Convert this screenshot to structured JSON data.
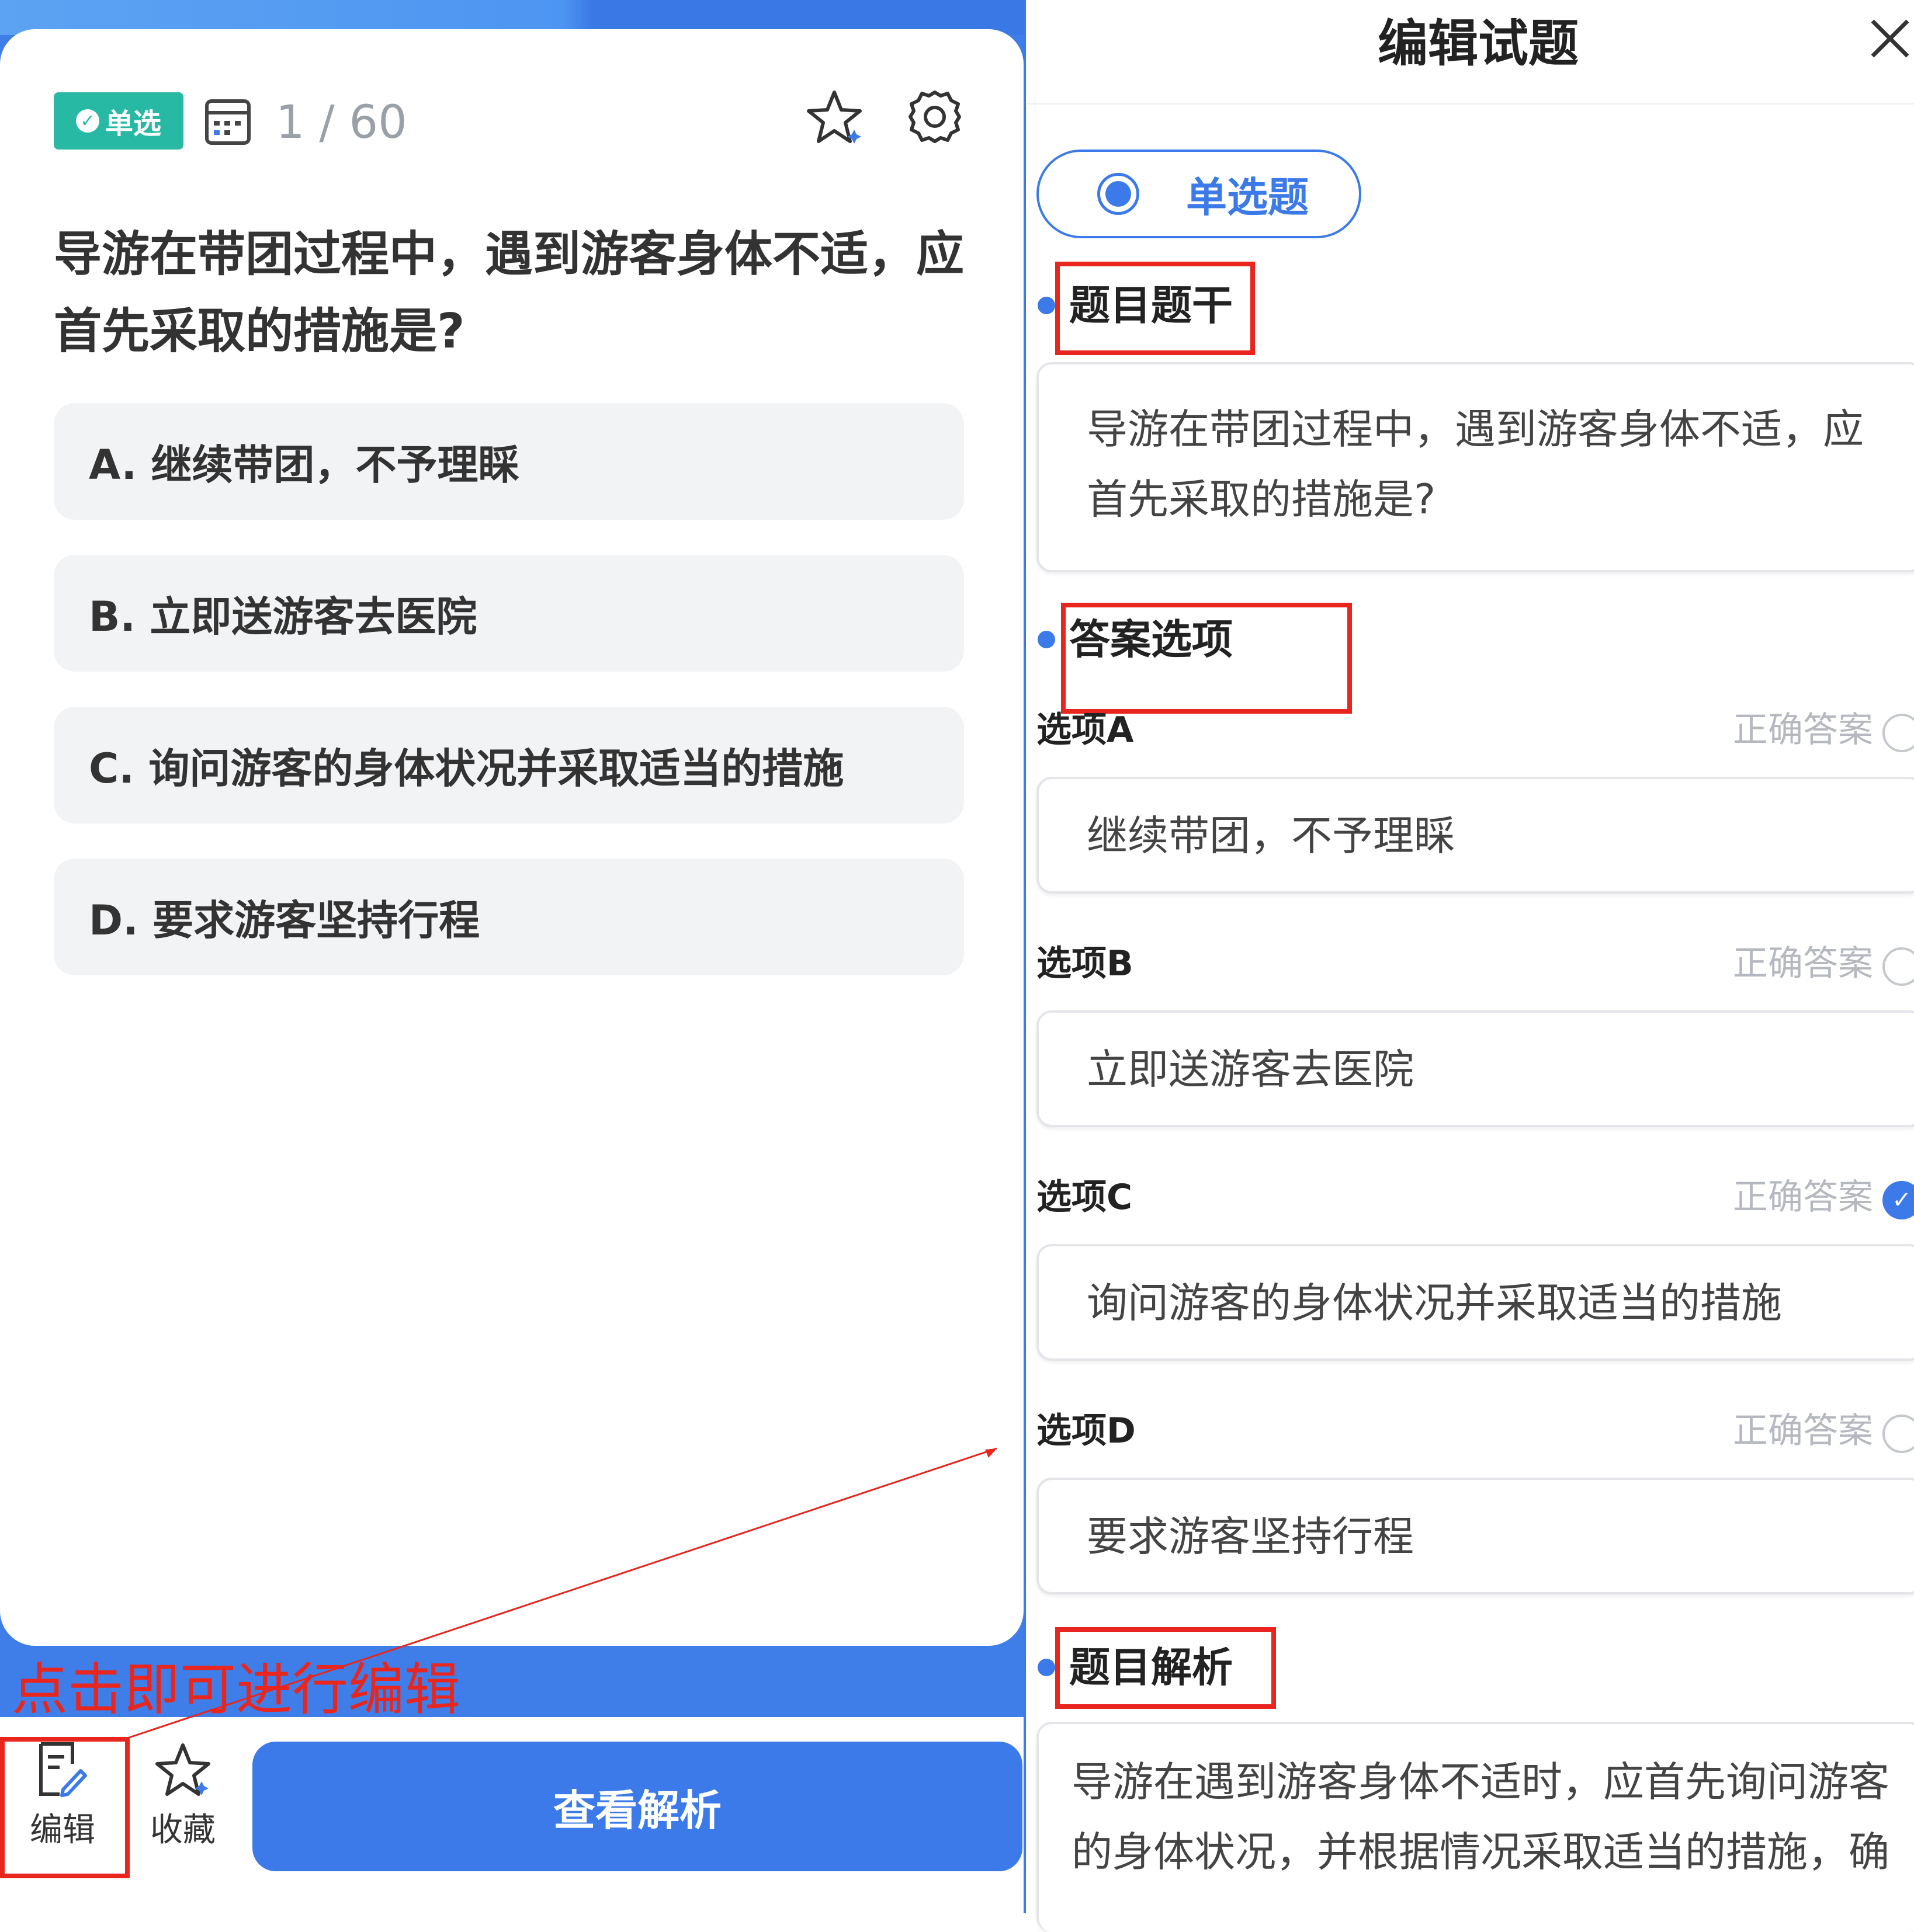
{
  "quiz": {
    "type_badge": "单选",
    "counter": "1 / 60",
    "question": "导游在带团过程中，遇到游客身体不适，应首先采取的措施是?",
    "options": [
      "A. 继续带团，不予理睬",
      "B. 立即送游客去医院",
      "C. 询问游客的身体状况并采取适当的措施",
      "D. 要求游客坚持行程"
    ],
    "bottom": {
      "edit_label": "编辑",
      "favorite_label": "收藏",
      "analysis_button": "查看解析"
    }
  },
  "annotation": {
    "caption": "点击即可进行编辑",
    "color": "#e8261e"
  },
  "editor": {
    "title": "编辑试题",
    "question_type": "单选题",
    "stem_section": "题目题干",
    "stem_text_line1": "导游在带团过程中，遇到游客身体不适，应",
    "stem_text_line2": "首先采取的措施是?",
    "options_section": "答案选项",
    "correct_label": "正确答案",
    "options": [
      {
        "label": "选项A",
        "value": "继续带团，不予理睬",
        "correct": false
      },
      {
        "label": "选项B",
        "value": "立即送游客去医院",
        "correct": false
      },
      {
        "label": "选项C",
        "value": "询问游客的身体状况并采取适当的措施",
        "correct": true
      },
      {
        "label": "选项D",
        "value": "要求游客坚持行程",
        "correct": false
      }
    ],
    "analysis_section": "题目解析",
    "analysis_line1": "导游在遇到游客身体不适时，应首先询问游客",
    "analysis_line2": "的身体状况，并根据情况采取适当的措施，确"
  },
  "colors": {
    "accent": "#3b7ae8",
    "badge": "#27b9a4",
    "annotation_red": "#e8261e"
  }
}
